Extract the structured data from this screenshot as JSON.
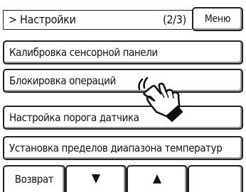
{
  "header": {
    "title": "> Настройки",
    "page_indicator": "(2/3)",
    "menu_label": "Меню"
  },
  "items": [
    {
      "label": "Калибровка сенсорной панели"
    },
    {
      "label": "Блокировка операций"
    },
    {
      "label": "Настройка порога датчика"
    },
    {
      "label": "Установка пределов диапазона температур"
    }
  ],
  "footer": {
    "back_label": "Возврат",
    "down_icon": "triangle-down",
    "up_icon": "triangle-up"
  },
  "pointer": {
    "icon": "hand-pointer-icon"
  }
}
